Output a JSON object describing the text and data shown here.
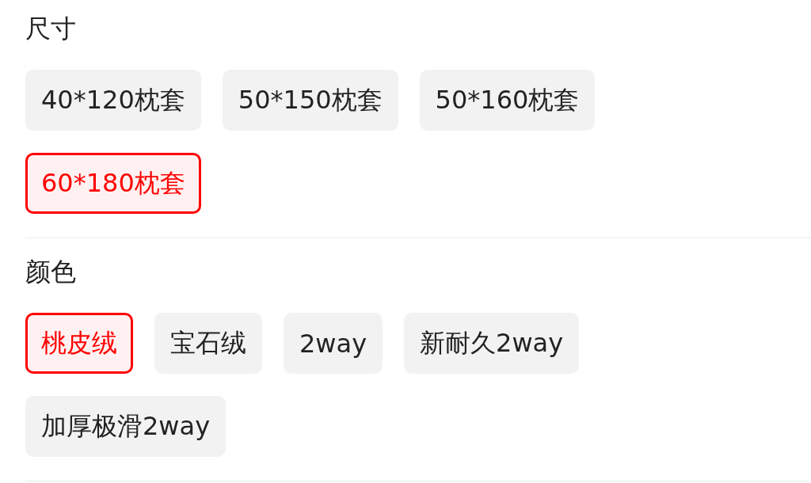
{
  "sections": [
    {
      "title": "尺寸",
      "options": [
        {
          "label": "40*120枕套",
          "selected": false
        },
        {
          "label": "50*150枕套",
          "selected": false
        },
        {
          "label": "50*160枕套",
          "selected": false
        },
        {
          "label": "60*180枕套",
          "selected": true
        }
      ]
    },
    {
      "title": "颜色",
      "options": [
        {
          "label": "桃皮绒",
          "selected": true
        },
        {
          "label": "宝石绒",
          "selected": false
        },
        {
          "label": "2way",
          "selected": false
        },
        {
          "label": "新耐久2way",
          "selected": false
        },
        {
          "label": "加厚极滑2way",
          "selected": false
        }
      ]
    }
  ]
}
